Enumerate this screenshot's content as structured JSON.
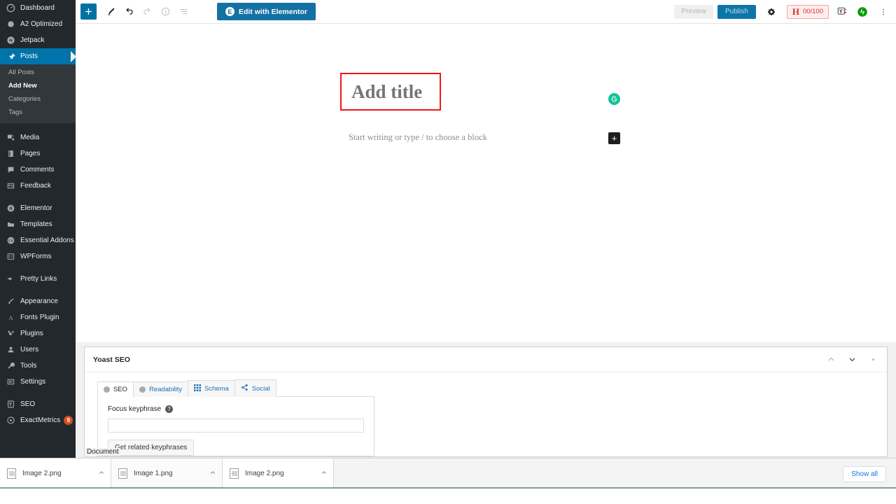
{
  "sidebar": {
    "items": [
      {
        "label": "Dashboard",
        "icon": "dashboard-icon",
        "current": false
      },
      {
        "label": "A2 Optimized",
        "icon": "gear-icon",
        "current": false
      },
      {
        "label": "Jetpack",
        "icon": "jetpack-icon",
        "current": false
      },
      {
        "label": "Posts",
        "icon": "pin-icon",
        "current": true
      },
      {
        "label": "Media",
        "icon": "media-icon",
        "current": false
      },
      {
        "label": "Pages",
        "icon": "pages-icon",
        "current": false
      },
      {
        "label": "Comments",
        "icon": "comments-icon",
        "current": false
      },
      {
        "label": "Feedback",
        "icon": "feedback-icon",
        "current": false
      },
      {
        "label": "Elementor",
        "icon": "elementor-icon",
        "current": false
      },
      {
        "label": "Templates",
        "icon": "folder-icon",
        "current": false
      },
      {
        "label": "Essential Addons",
        "icon": "essential-addons-icon",
        "current": false
      },
      {
        "label": "WPForms",
        "icon": "wpforms-icon",
        "current": false
      },
      {
        "label": "Pretty Links",
        "icon": "link-icon",
        "current": false
      },
      {
        "label": "Appearance",
        "icon": "brush-icon",
        "current": false
      },
      {
        "label": "Fonts Plugin",
        "icon": "font-a-icon",
        "current": false
      },
      {
        "label": "Plugins",
        "icon": "plug-icon",
        "current": false
      },
      {
        "label": "Users",
        "icon": "user-icon",
        "current": false
      },
      {
        "label": "Tools",
        "icon": "wrench-icon",
        "current": false
      },
      {
        "label": "Settings",
        "icon": "settings-icon",
        "current": false
      },
      {
        "label": "SEO",
        "icon": "yoast-icon",
        "current": false
      },
      {
        "label": "ExactMetrics",
        "icon": "exactmetrics-icon",
        "current": false,
        "badge": "9"
      }
    ],
    "posts_submenu": [
      {
        "label": "All Posts",
        "current": false
      },
      {
        "label": "Add New",
        "current": true
      },
      {
        "label": "Categories",
        "current": false
      },
      {
        "label": "Tags",
        "current": false
      }
    ]
  },
  "toolbar": {
    "add_block_label": "+",
    "tools_icon": "pencil-icon",
    "undo_icon": "undo-icon",
    "redo_icon": "redo-icon",
    "info_icon": "info-icon",
    "list_view_icon": "list-view-icon",
    "elementor_button": "Edit with Elementor",
    "elementor_badge": "E",
    "preview_label": "Preview",
    "publish_label": "Publish",
    "settings_icon": "gear-icon",
    "heading_badge_letter": "H",
    "heading_badge_score": "00/100",
    "yoast_icon": "yoast-icon",
    "jetpack_icon": "jetpack-bolt-icon",
    "more_icon": "kebab-menu-icon"
  },
  "editor": {
    "title_placeholder": "Add title",
    "block_placeholder": "Start writing or type / to choose a block",
    "grammarly_icon": "grammarly-icon",
    "add_block_plus": "+",
    "highlight_color": "#f21616"
  },
  "metabox": {
    "title": "Yoast SEO",
    "collapse_up_icon": "chevron-up-icon",
    "collapse_down_icon": "chevron-down-icon",
    "toggle_icon": "caret-up-icon",
    "tabs": [
      {
        "label": "SEO",
        "icon": "gray-dot-icon",
        "active": true
      },
      {
        "label": "Readability",
        "icon": "gray-dot-icon",
        "active": false
      },
      {
        "label": "Schema",
        "icon": "grid-icon",
        "active": false
      },
      {
        "label": "Social",
        "icon": "share-icon",
        "active": false
      }
    ],
    "focus_keyphrase_label": "Focus keyphrase",
    "help_icon": "help-icon",
    "focus_keyphrase_value": "",
    "get_related_label": "Get related keyphrases",
    "document_label": "Document"
  },
  "downloads": {
    "items": [
      {
        "name": "Image 2.png",
        "icon": "png-file-icon",
        "caret": "chevron-up-icon",
        "focused": false
      },
      {
        "name": "Image 1.png",
        "icon": "png-file-icon",
        "caret": "chevron-up-icon",
        "focused": true
      },
      {
        "name": "Image 2.png",
        "icon": "png-file-icon",
        "caret": "chevron-up-icon",
        "focused": false
      }
    ],
    "show_all_label": "Show all"
  }
}
